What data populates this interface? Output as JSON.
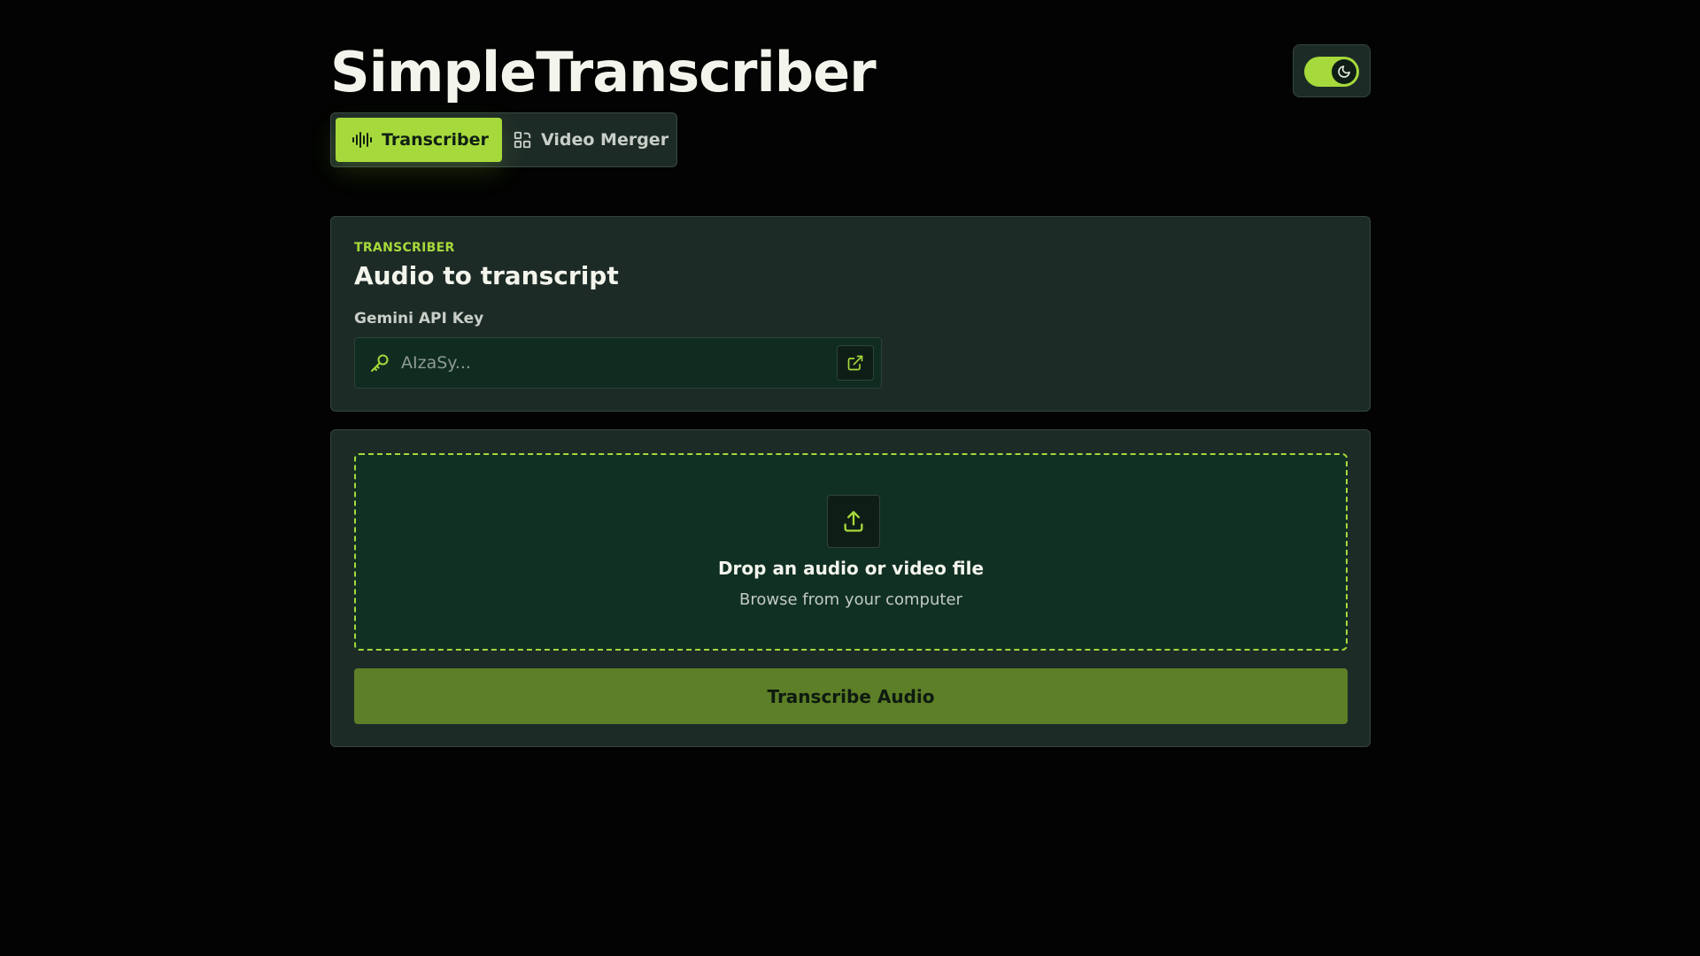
{
  "app": {
    "title": "SimpleTranscriber"
  },
  "theme_toggle": {
    "icon": "moon-icon",
    "state": "dark"
  },
  "tabs": [
    {
      "label": "Transcriber",
      "icon": "waveform-icon",
      "active": true
    },
    {
      "label": "Video Merger",
      "icon": "merge-icon",
      "active": false
    }
  ],
  "settings_card": {
    "eyebrow": "TRANSCRIBER",
    "title": "Audio to transcript",
    "api_key": {
      "label": "Gemini API Key",
      "placeholder": "AIzaSy...",
      "value": "",
      "icon": "key-icon",
      "link_icon": "external-link-icon"
    }
  },
  "upload_card": {
    "dropzone": {
      "icon": "upload-icon",
      "title": "Drop an audio or video file",
      "subtitle": "Browse from your computer"
    },
    "submit_label": "Transcribe Audio"
  },
  "colors": {
    "background": "#020302",
    "card": "#1d2b27",
    "accent": "#a6d93b",
    "button": "#5c7f27",
    "dropzone": "#113024"
  }
}
